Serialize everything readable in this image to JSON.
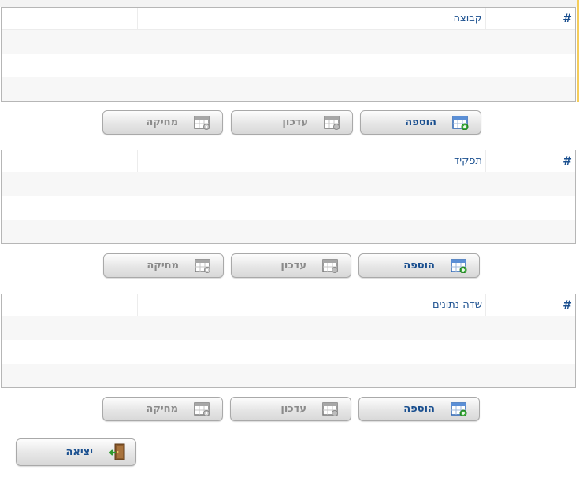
{
  "panels": [
    {
      "hash": "#",
      "column": "קבוצה",
      "buttons": {
        "add": "הוספה",
        "update": "עדכון",
        "delete": "מחיקה"
      }
    },
    {
      "hash": "#",
      "column": "תפקיד",
      "buttons": {
        "add": "הוספה",
        "update": "עדכון",
        "delete": "מחיקה"
      }
    },
    {
      "hash": "#",
      "column": "שדה נתונים",
      "buttons": {
        "add": "הוספה",
        "update": "עדכון",
        "delete": "מחיקה"
      }
    }
  ],
  "exit": {
    "label": "יציאה"
  },
  "colors": {
    "header_text": "#1a4f8f",
    "disabled_text": "#8a8a8a",
    "row_alt": "#f7f7f7",
    "accent": "#f5cd5a"
  },
  "icons": {
    "add": "grid-add-icon",
    "update": "grid-edit-icon",
    "delete": "grid-delete-icon",
    "exit": "door-exit-icon"
  }
}
